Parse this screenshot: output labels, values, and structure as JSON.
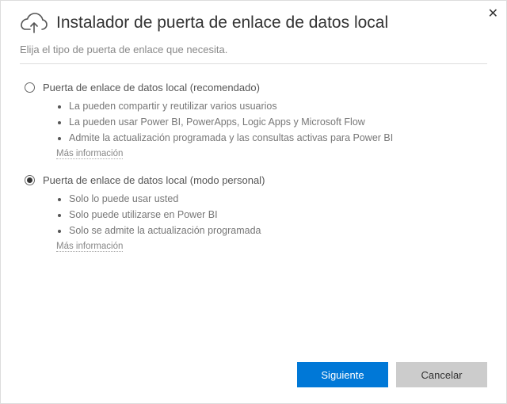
{
  "header": {
    "title": "Instalador de puerta de enlace de datos local"
  },
  "subtitle": "Elija el tipo de puerta de enlace que necesita.",
  "options": {
    "recommended": {
      "label": "Puerta de enlace de datos local (recomendado)",
      "bullets": [
        "La pueden compartir y reutilizar varios usuarios",
        "La pueden usar Power BI, PowerApps, Logic Apps y Microsoft Flow",
        "Admite la actualización programada y las consultas activas para Power BI"
      ],
      "more_info": "Más información",
      "selected": false
    },
    "personal": {
      "label": "Puerta de enlace de datos local (modo personal)",
      "bullets": [
        "Solo lo puede usar usted",
        "Solo puede utilizarse en Power BI",
        "Solo se admite la actualización programada"
      ],
      "more_info": "Más información",
      "selected": true
    }
  },
  "footer": {
    "next": "Siguiente",
    "cancel": "Cancelar"
  }
}
